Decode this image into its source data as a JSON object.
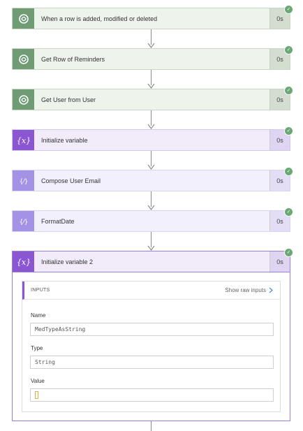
{
  "steps": [
    {
      "title": "When a row is added, modified or deleted",
      "duration": "0s",
      "icon": "dataverse-icon",
      "color": "green"
    },
    {
      "title": "Get Row of Reminders",
      "duration": "0s",
      "icon": "dataverse-icon",
      "color": "green"
    },
    {
      "title": "Get User from User",
      "duration": "0s",
      "icon": "dataverse-icon",
      "color": "green"
    },
    {
      "title": "Initialize variable",
      "duration": "0s",
      "icon": "variable-icon",
      "color": "purple"
    },
    {
      "title": "Compose User Email",
      "duration": "0s",
      "icon": "compose-icon",
      "color": "lpurple"
    },
    {
      "title": "FormatDate",
      "duration": "0s",
      "icon": "compose-icon",
      "color": "lpurple"
    },
    {
      "title": "Initialize variable 2",
      "duration": "0s",
      "icon": "variable-icon",
      "color": "purple"
    }
  ],
  "inputs": {
    "header": "INPUTS",
    "show_raw": "Show raw inputs",
    "fields": [
      {
        "label": "Name",
        "value": "MedTypeAsString"
      },
      {
        "label": "Type",
        "value": "String"
      },
      {
        "label": "Value",
        "value": ""
      }
    ]
  },
  "colors": {
    "dataverse_green": "#6f9c75",
    "variable_purple": "#8b56d1",
    "compose_purple": "#a492e6",
    "success_check": "#6aa874"
  }
}
